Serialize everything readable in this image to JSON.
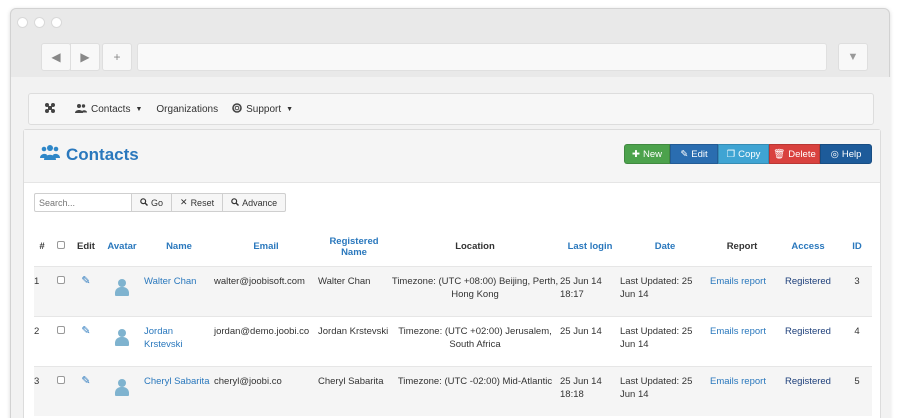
{
  "browser": {
    "back_icon": "◀",
    "forward_icon": "▶",
    "newtab_icon": "+",
    "menu_icon": "▼"
  },
  "nav": {
    "logo_icon": "joomla-logo-icon",
    "items": [
      {
        "label": "Contacts",
        "icon": "users-icon",
        "has_caret": true
      },
      {
        "label": "Organizations",
        "icon": "",
        "has_caret": false
      },
      {
        "label": "Support",
        "icon": "lifebuoy-icon",
        "has_caret": true
      }
    ]
  },
  "page": {
    "title": "Contacts",
    "title_icon": "users-icon"
  },
  "actions": {
    "new": "New",
    "edit": "Edit",
    "copy": "Copy",
    "delete": "Delete",
    "help": "Help"
  },
  "search": {
    "placeholder": "Search...",
    "go": "Go",
    "reset": "Reset",
    "advance": "Advance"
  },
  "table": {
    "headers": {
      "num": "#",
      "edit": "Edit",
      "avatar": "Avatar",
      "name": "Name",
      "email": "Email",
      "registered_name": "Registered Name",
      "location": "Location",
      "last_login": "Last login",
      "date": "Date",
      "report": "Report",
      "access": "Access",
      "id": "ID"
    },
    "rows": [
      {
        "num": "1",
        "name": "Walter Chan",
        "email": "walter@joobisoft.com",
        "registered_name": "Walter Chan",
        "location": "Timezone: (UTC +08:00) Beijing, Perth, Hong Kong",
        "last_login": "25 Jun 14 18:17",
        "date": "Last Updated: 25 Jun 14",
        "report": "Emails report",
        "access": "Registered",
        "id": "3"
      },
      {
        "num": "2",
        "name": "Jordan Krstevski",
        "email": "jordan@demo.joobi.co",
        "registered_name": "Jordan Krstevski",
        "location": "Timezone: (UTC +02:00) Jerusalem, South Africa",
        "last_login": "25 Jun 14",
        "date": "Last Updated: 25 Jun 14",
        "report": "Emails report",
        "access": "Registered",
        "id": "4"
      },
      {
        "num": "3",
        "name": "Cheryl Sabarita",
        "email": "cheryl@joobi.co",
        "registered_name": "Cheryl Sabarita",
        "location": "Timezone: (UTC -02:00) Mid-Atlantic",
        "last_login": "25 Jun 14 18:18",
        "date": "Last Updated: 25 Jun 14",
        "report": "Emails report",
        "access": "Registered",
        "id": "5"
      }
    ]
  },
  "colors": {
    "new": "#4ca24c",
    "edit": "#2a6db0",
    "copy": "#3fa4d3",
    "delete": "#d9413e",
    "help": "#1d5b9a",
    "link": "#2a78bd"
  }
}
